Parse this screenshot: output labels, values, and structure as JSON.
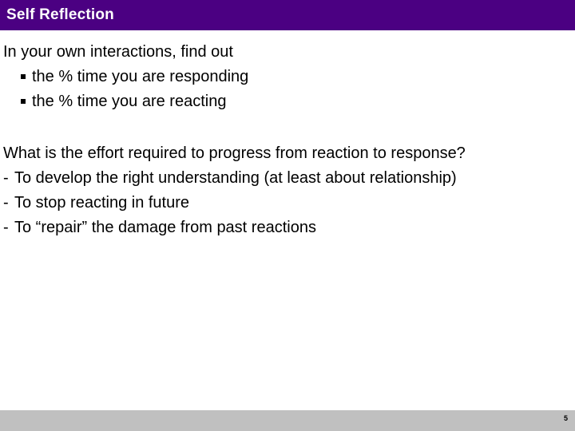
{
  "slide": {
    "title": "Self Reflection",
    "title_bar_color": "#4B0082",
    "title_text_color": "#FFFFFF",
    "body_text_color": "#000000",
    "background_color": "#FFFFFF",
    "footer_bar_color": "#C0C0C0",
    "page_number": "5"
  },
  "blocks": [
    {
      "id": "reflection-prompt",
      "lines": [
        {
          "level": 0,
          "marker": "",
          "text": "In your own interactions, find out"
        },
        {
          "level": 1,
          "marker": "square-bullet",
          "text": "the % time you are responding"
        },
        {
          "level": 1,
          "marker": "square-bullet",
          "text": "the % time you are reacting"
        }
      ]
    },
    {
      "id": "effort-required",
      "lines": [
        {
          "level": 0,
          "marker": "",
          "text": "What is the effort required to progress from reaction to response?"
        },
        {
          "level": 2,
          "marker": "-",
          "text": "To develop the right understanding (at least about relationship)"
        },
        {
          "level": 2,
          "marker": "-",
          "text": "To stop reacting in future"
        },
        {
          "level": 2,
          "marker": "-",
          "text": "To “repair” the damage from past reactions"
        }
      ]
    }
  ]
}
